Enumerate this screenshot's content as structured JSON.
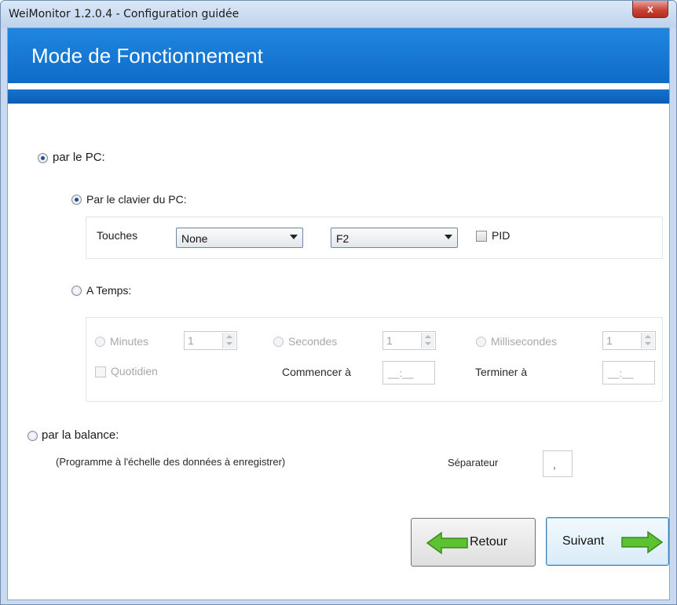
{
  "window": {
    "title": "WeiMonitor 1.2.0.4 - Configuration guidée",
    "close_glyph": "x"
  },
  "banner": {
    "title": "Mode de Fonctionnement"
  },
  "mode_pc": {
    "label": "par le PC:",
    "selected": true,
    "keyboard": {
      "label": "Par le clavier du PC:",
      "selected": true,
      "keys_label": "Touches",
      "modifier_value": "None",
      "key_value": "F2",
      "pid_label": "PID",
      "pid_checked": false
    },
    "timed": {
      "label": "A Temps:",
      "selected": false,
      "minutes_label": "Minutes",
      "minutes_value": "1",
      "seconds_label": "Secondes",
      "seconds_value": "1",
      "ms_label": "Millisecondes",
      "ms_value": "1",
      "daily_label": "Quotidien",
      "start_label": "Commencer à",
      "start_value": "__:__",
      "end_label": "Terminer à",
      "end_value": "__:__"
    }
  },
  "mode_scale": {
    "label": "par la balance:",
    "selected": false,
    "hint": "(Programme à l'échelle des données à enregistrer)",
    "separator_label": "Séparateur",
    "separator_value": ","
  },
  "buttons": {
    "back": "Retour",
    "next": "Suivant"
  },
  "colors": {
    "banner": "#1279d6",
    "arrow_green": "#5cc232"
  }
}
